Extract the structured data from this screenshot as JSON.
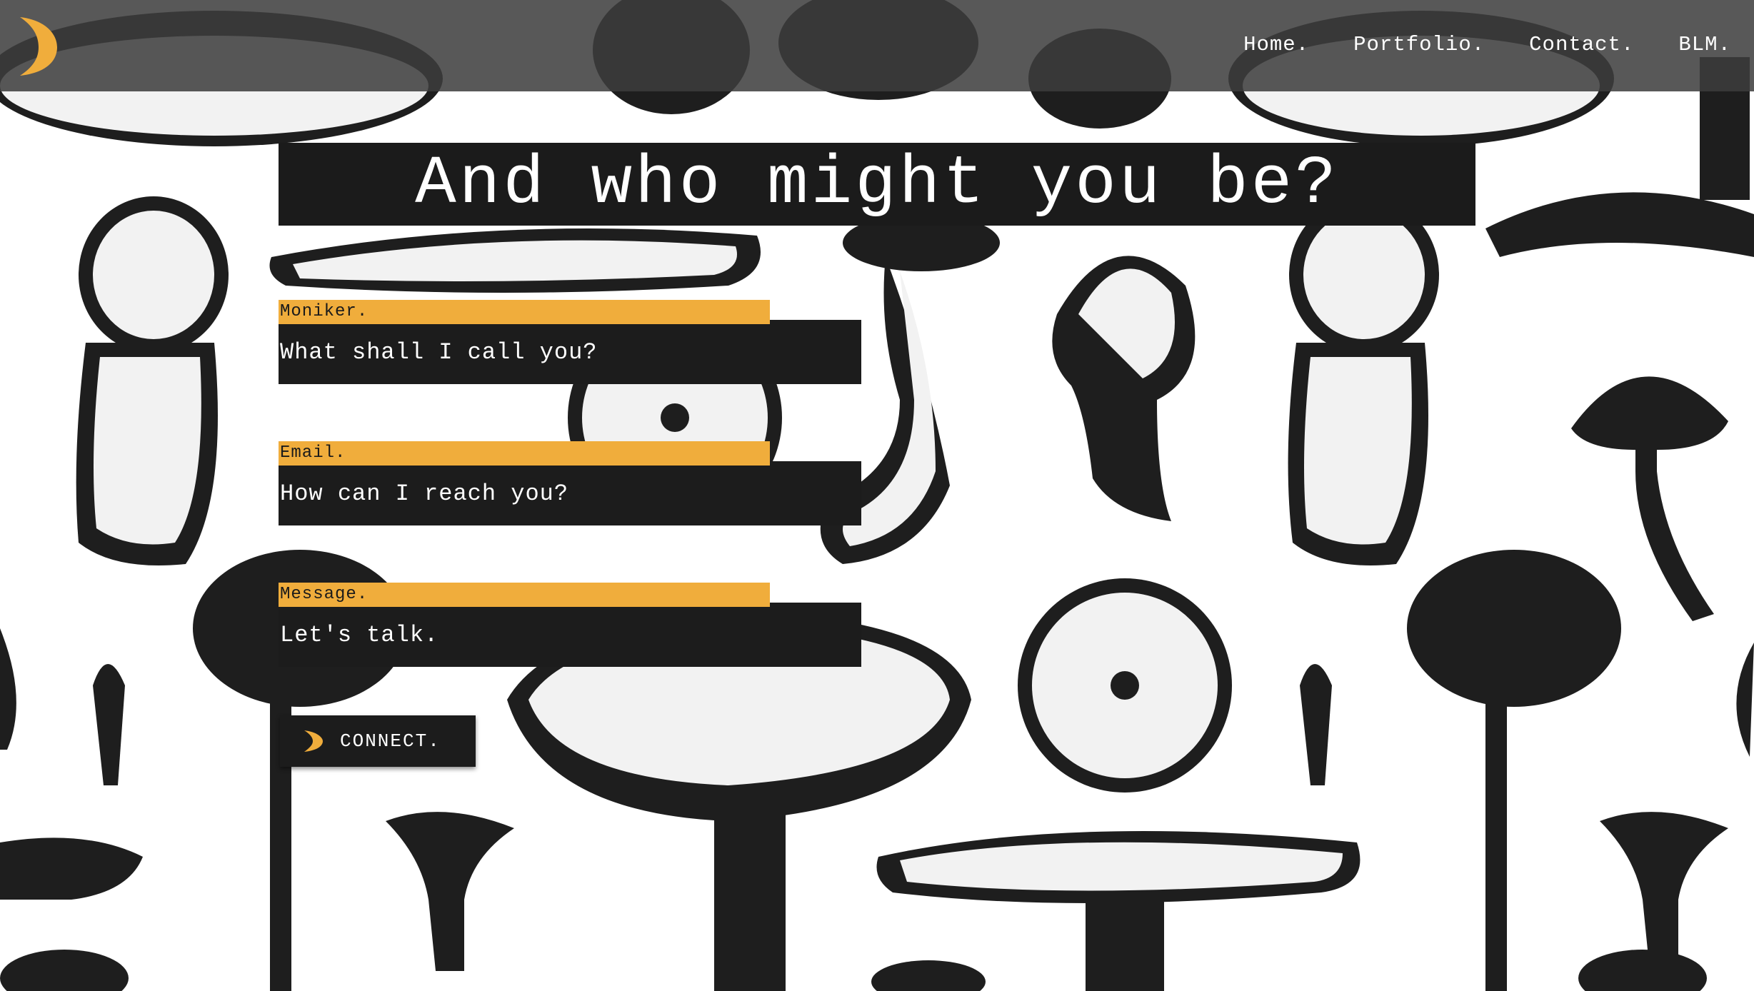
{
  "header": {
    "logo_icon": "crescent-moon-icon",
    "nav": [
      {
        "label": "Home."
      },
      {
        "label": "Portfolio."
      },
      {
        "label": "Contact."
      },
      {
        "label": "BLM."
      }
    ]
  },
  "main": {
    "title": "And who might you be?",
    "fields": [
      {
        "label": "Moniker.",
        "placeholder": "What shall I call you?"
      },
      {
        "label": "Email.",
        "placeholder": "How can I reach you?"
      },
      {
        "label": "Message.",
        "placeholder": "Let's talk."
      }
    ],
    "submit": {
      "label": "CONNECT.",
      "icon": "crescent-moon-icon"
    }
  },
  "background": {
    "image": "mushroom-illustration-pattern"
  },
  "colors": {
    "accent": "#f0ad3c",
    "panel": "#1c1c1c",
    "header": "#3c3c3c",
    "text_light": "#ffffff"
  }
}
